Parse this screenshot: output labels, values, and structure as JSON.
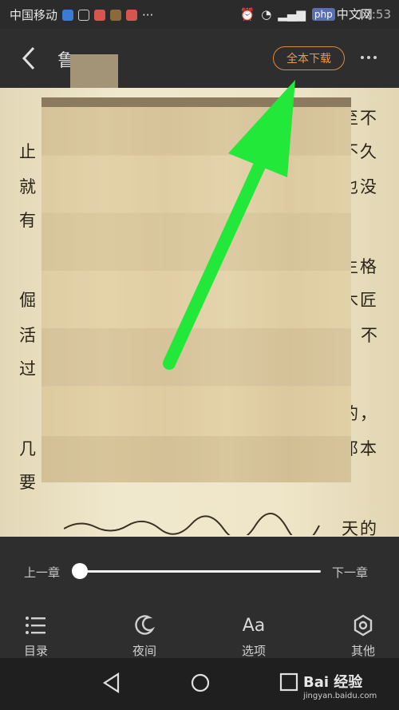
{
  "status_bar": {
    "carrier": "中国移动",
    "dots": "···",
    "time": "12:53",
    "php_badge": "php",
    "php_site": "中文网"
  },
  "toolbar": {
    "title_visible": "鲁",
    "download_label": "全本下载"
  },
  "page_text": {
    "right_fragments": [
      "至不",
      "不久",
      "也没",
      "生格",
      "木匠",
      "不",
      "的，",
      "邓本",
      "天的"
    ],
    "left_fragments": [
      "止",
      "就",
      "有",
      "倔",
      "活",
      "过",
      "几",
      "要"
    ]
  },
  "chapter_nav": {
    "prev_label": "上一章",
    "next_label": "下一章",
    "progress_fraction": 0.0
  },
  "bottom_tools": [
    {
      "label": "目录",
      "icon": "catalog-icon"
    },
    {
      "label": "夜间",
      "icon": "night-mode-icon"
    },
    {
      "label": "选项",
      "icon": "font-options-icon"
    },
    {
      "label": "其他",
      "icon": "settings-icon"
    }
  ],
  "watermark": {
    "brand": "Bai 经验",
    "url": "jingyan.baidu.com"
  },
  "colors": {
    "accent": "#e99a4c",
    "arrow": "#22e83a",
    "panel": "#2e2e2e"
  }
}
